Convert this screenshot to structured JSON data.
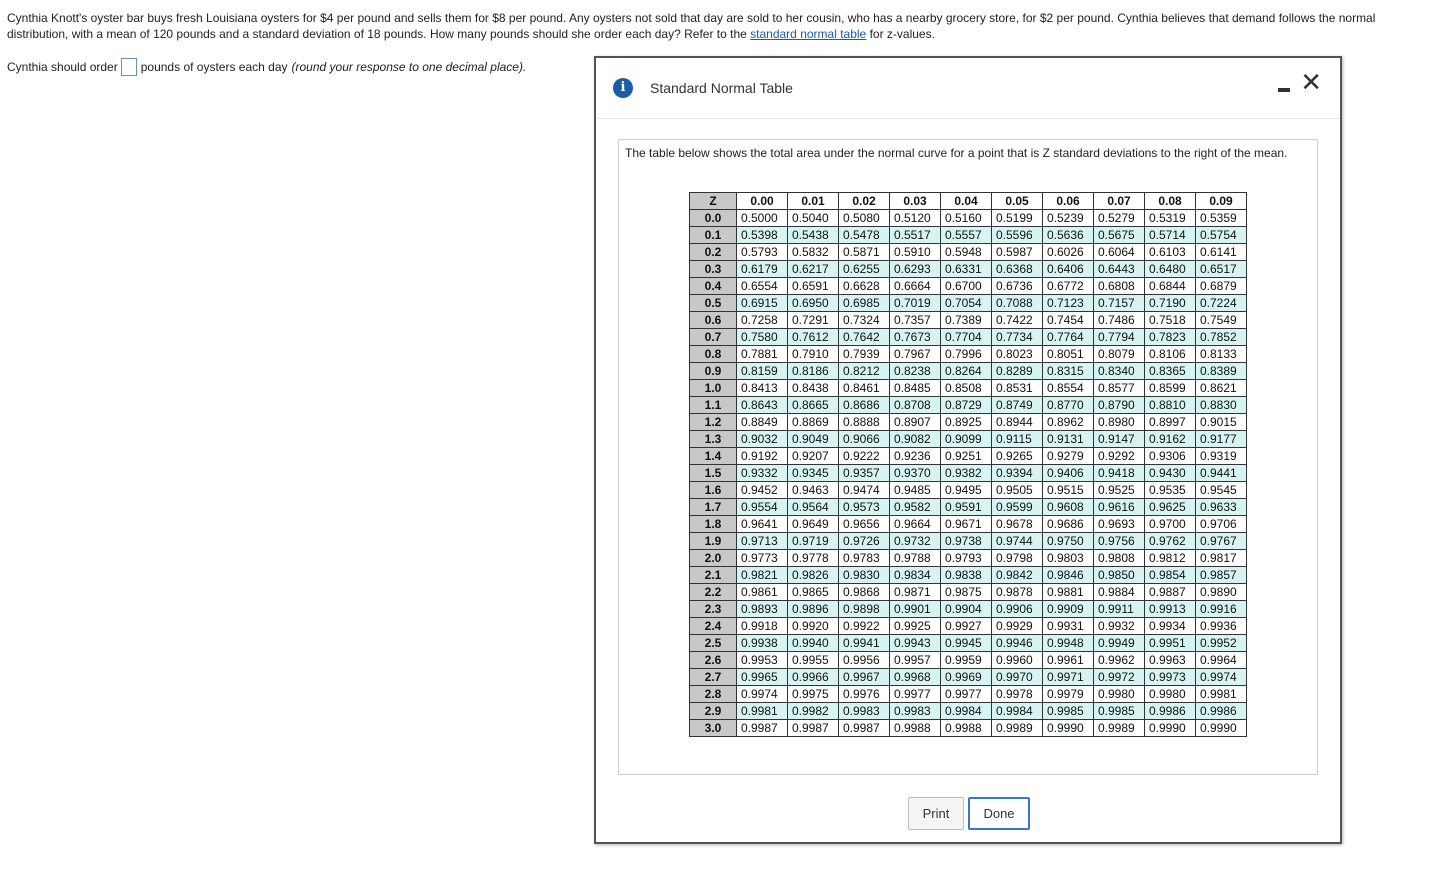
{
  "question": {
    "text_before_link": "Cynthia Knott's oyster bar buys fresh Louisiana oysters for $4 per pound and sells them for $8 per pound. Any oysters not sold that day are sold to her cousin, who has a nearby grocery store, for $2 per pound. Cynthia believes that demand follows the normal distribution, with a mean of 120 pounds and a standard deviation of 18 pounds. How many pounds should she order each day? Refer to the ",
    "link_text": "standard normal table",
    "text_after_link": " for z-values."
  },
  "answer": {
    "prefix": "Cynthia should order",
    "input_value": "",
    "suffix": "pounds of oysters each day",
    "hint": "(round your response to one decimal place)."
  },
  "dialog": {
    "title": "Standard Normal Table",
    "icon": "info-icon",
    "minimize_glyph": "",
    "close_glyph": "✕",
    "intro": "The table below shows the total area under the normal curve for a point that is Z standard deviations to the right of the mean.",
    "print_label": "Print",
    "done_label": "Done"
  },
  "colors": {
    "link": "#1a5ca8",
    "icon_bg": "#1a5ca8",
    "row_alt": "#d6f5f2",
    "header_gray": "#c8c8c8",
    "done_border": "#3a78c6"
  },
  "table": {
    "headers": [
      "Z",
      "0.00",
      "0.01",
      "0.02",
      "0.03",
      "0.04",
      "0.05",
      "0.06",
      "0.07",
      "0.08",
      "0.09"
    ],
    "rows": [
      {
        "z": "0.0",
        "values": [
          "0.5000",
          "0.5040",
          "0.5080",
          "0.5120",
          "0.5160",
          "0.5199",
          "0.5239",
          "0.5279",
          "0.5319",
          "0.5359"
        ]
      },
      {
        "z": "0.1",
        "values": [
          "0.5398",
          "0.5438",
          "0.5478",
          "0.5517",
          "0.5557",
          "0.5596",
          "0.5636",
          "0.5675",
          "0.5714",
          "0.5754"
        ]
      },
      {
        "z": "0.2",
        "values": [
          "0.5793",
          "0.5832",
          "0.5871",
          "0.5910",
          "0.5948",
          "0.5987",
          "0.6026",
          "0.6064",
          "0.6103",
          "0.6141"
        ]
      },
      {
        "z": "0.3",
        "values": [
          "0.6179",
          "0.6217",
          "0.6255",
          "0.6293",
          "0.6331",
          "0.6368",
          "0.6406",
          "0.6443",
          "0.6480",
          "0.6517"
        ]
      },
      {
        "z": "0.4",
        "values": [
          "0.6554",
          "0.6591",
          "0.6628",
          "0.6664",
          "0.6700",
          "0.6736",
          "0.6772",
          "0.6808",
          "0.6844",
          "0.6879"
        ]
      },
      {
        "z": "0.5",
        "values": [
          "0.6915",
          "0.6950",
          "0.6985",
          "0.7019",
          "0.7054",
          "0.7088",
          "0.7123",
          "0.7157",
          "0.7190",
          "0.7224"
        ]
      },
      {
        "z": "0.6",
        "values": [
          "0.7258",
          "0.7291",
          "0.7324",
          "0.7357",
          "0.7389",
          "0.7422",
          "0.7454",
          "0.7486",
          "0.7518",
          "0.7549"
        ]
      },
      {
        "z": "0.7",
        "values": [
          "0.7580",
          "0.7612",
          "0.7642",
          "0.7673",
          "0.7704",
          "0.7734",
          "0.7764",
          "0.7794",
          "0.7823",
          "0.7852"
        ]
      },
      {
        "z": "0.8",
        "values": [
          "0.7881",
          "0.7910",
          "0.7939",
          "0.7967",
          "0.7996",
          "0.8023",
          "0.8051",
          "0.8079",
          "0.8106",
          "0.8133"
        ]
      },
      {
        "z": "0.9",
        "values": [
          "0.8159",
          "0.8186",
          "0.8212",
          "0.8238",
          "0.8264",
          "0.8289",
          "0.8315",
          "0.8340",
          "0.8365",
          "0.8389"
        ]
      },
      {
        "z": "1.0",
        "values": [
          "0.8413",
          "0.8438",
          "0.8461",
          "0.8485",
          "0.8508",
          "0.8531",
          "0.8554",
          "0.8577",
          "0.8599",
          "0.8621"
        ]
      },
      {
        "z": "1.1",
        "values": [
          "0.8643",
          "0.8665",
          "0.8686",
          "0.8708",
          "0.8729",
          "0.8749",
          "0.8770",
          "0.8790",
          "0.8810",
          "0.8830"
        ]
      },
      {
        "z": "1.2",
        "values": [
          "0.8849",
          "0.8869",
          "0.8888",
          "0.8907",
          "0.8925",
          "0.8944",
          "0.8962",
          "0.8980",
          "0.8997",
          "0.9015"
        ]
      },
      {
        "z": "1.3",
        "values": [
          "0.9032",
          "0.9049",
          "0.9066",
          "0.9082",
          "0.9099",
          "0.9115",
          "0.9131",
          "0.9147",
          "0.9162",
          "0.9177"
        ]
      },
      {
        "z": "1.4",
        "values": [
          "0.9192",
          "0.9207",
          "0.9222",
          "0.9236",
          "0.9251",
          "0.9265",
          "0.9279",
          "0.9292",
          "0.9306",
          "0.9319"
        ]
      },
      {
        "z": "1.5",
        "values": [
          "0.9332",
          "0.9345",
          "0.9357",
          "0.9370",
          "0.9382",
          "0.9394",
          "0.9406",
          "0.9418",
          "0.9430",
          "0.9441"
        ]
      },
      {
        "z": "1.6",
        "values": [
          "0.9452",
          "0.9463",
          "0.9474",
          "0.9485",
          "0.9495",
          "0.9505",
          "0.9515",
          "0.9525",
          "0.9535",
          "0.9545"
        ]
      },
      {
        "z": "1.7",
        "values": [
          "0.9554",
          "0.9564",
          "0.9573",
          "0.9582",
          "0.9591",
          "0.9599",
          "0.9608",
          "0.9616",
          "0.9625",
          "0.9633"
        ]
      },
      {
        "z": "1.8",
        "values": [
          "0.9641",
          "0.9649",
          "0.9656",
          "0.9664",
          "0.9671",
          "0.9678",
          "0.9686",
          "0.9693",
          "0.9700",
          "0.9706"
        ]
      },
      {
        "z": "1.9",
        "values": [
          "0.9713",
          "0.9719",
          "0.9726",
          "0.9732",
          "0.9738",
          "0.9744",
          "0.9750",
          "0.9756",
          "0.9762",
          "0.9767"
        ]
      },
      {
        "z": "2.0",
        "values": [
          "0.9773",
          "0.9778",
          "0.9783",
          "0.9788",
          "0.9793",
          "0.9798",
          "0.9803",
          "0.9808",
          "0.9812",
          "0.9817"
        ]
      },
      {
        "z": "2.1",
        "values": [
          "0.9821",
          "0.9826",
          "0.9830",
          "0.9834",
          "0.9838",
          "0.9842",
          "0.9846",
          "0.9850",
          "0.9854",
          "0.9857"
        ]
      },
      {
        "z": "2.2",
        "values": [
          "0.9861",
          "0.9865",
          "0.9868",
          "0.9871",
          "0.9875",
          "0.9878",
          "0.9881",
          "0.9884",
          "0.9887",
          "0.9890"
        ]
      },
      {
        "z": "2.3",
        "values": [
          "0.9893",
          "0.9896",
          "0.9898",
          "0.9901",
          "0.9904",
          "0.9906",
          "0.9909",
          "0.9911",
          "0.9913",
          "0.9916"
        ]
      },
      {
        "z": "2.4",
        "values": [
          "0.9918",
          "0.9920",
          "0.9922",
          "0.9925",
          "0.9927",
          "0.9929",
          "0.9931",
          "0.9932",
          "0.9934",
          "0.9936"
        ]
      },
      {
        "z": "2.5",
        "values": [
          "0.9938",
          "0.9940",
          "0.9941",
          "0.9943",
          "0.9945",
          "0.9946",
          "0.9948",
          "0.9949",
          "0.9951",
          "0.9952"
        ]
      },
      {
        "z": "2.6",
        "values": [
          "0.9953",
          "0.9955",
          "0.9956",
          "0.9957",
          "0.9959",
          "0.9960",
          "0.9961",
          "0.9962",
          "0.9963",
          "0.9964"
        ]
      },
      {
        "z": "2.7",
        "values": [
          "0.9965",
          "0.9966",
          "0.9967",
          "0.9968",
          "0.9969",
          "0.9970",
          "0.9971",
          "0.9972",
          "0.9973",
          "0.9974"
        ]
      },
      {
        "z": "2.8",
        "values": [
          "0.9974",
          "0.9975",
          "0.9976",
          "0.9977",
          "0.9977",
          "0.9978",
          "0.9979",
          "0.9980",
          "0.9980",
          "0.9981"
        ]
      },
      {
        "z": "2.9",
        "values": [
          "0.9981",
          "0.9982",
          "0.9983",
          "0.9983",
          "0.9984",
          "0.9984",
          "0.9985",
          "0.9985",
          "0.9986",
          "0.9986"
        ]
      },
      {
        "z": "3.0",
        "values": [
          "0.9987",
          "0.9987",
          "0.9987",
          "0.9988",
          "0.9988",
          "0.9989",
          "0.9990",
          "0.9989",
          "0.9990",
          "0.9990"
        ]
      }
    ]
  }
}
